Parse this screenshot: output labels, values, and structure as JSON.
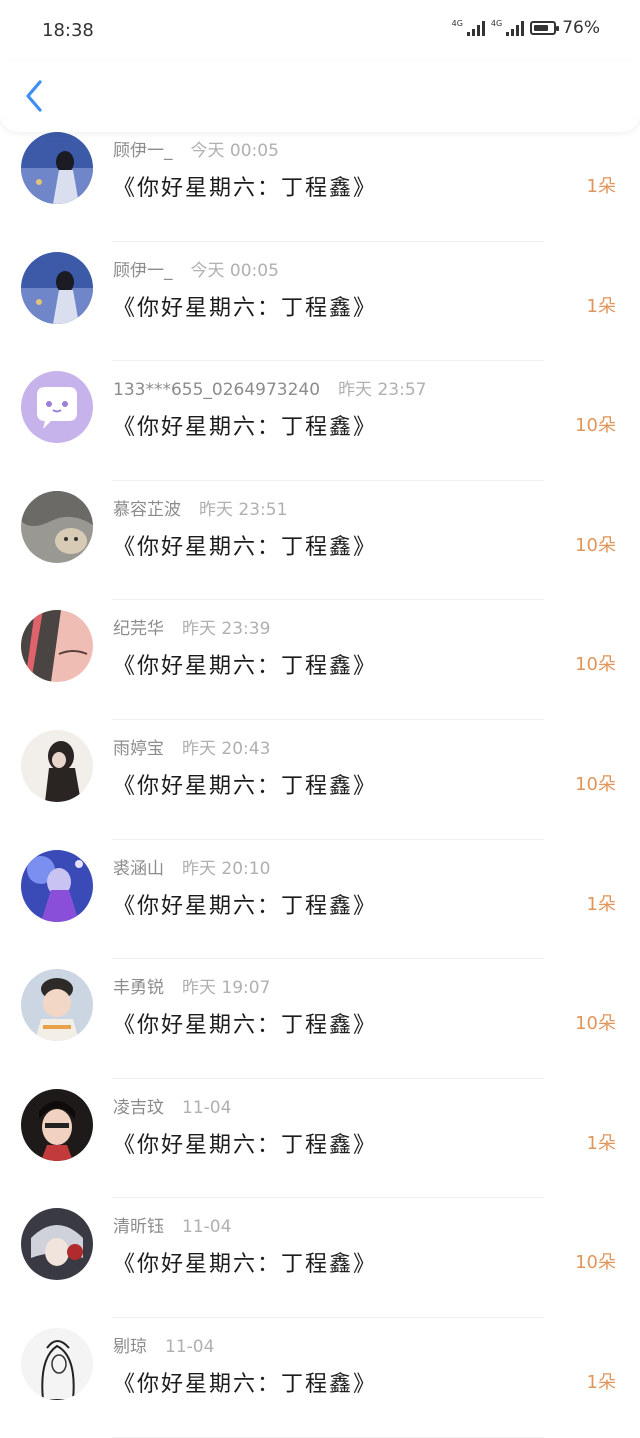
{
  "status_bar": {
    "time": "18:38",
    "network_1": "4G",
    "network_2": "4G",
    "battery_percent": "76%",
    "battery_level": 0.76
  },
  "gift_list": {
    "items": [
      {
        "user": "顾伊一_",
        "time": "今天 00:05",
        "title": "《你好星期六：丁程鑫》",
        "count": "1朵"
      },
      {
        "user": "顾伊一_",
        "time": "今天 00:05",
        "title": "《你好星期六：丁程鑫》",
        "count": "1朵"
      },
      {
        "user": "133***655_0264973240",
        "time": "昨天 23:57",
        "title": "《你好星期六：丁程鑫》",
        "count": "10朵"
      },
      {
        "user": "慕容芷波",
        "time": "昨天 23:51",
        "title": "《你好星期六：丁程鑫》",
        "count": "10朵"
      },
      {
        "user": "纪芫华",
        "time": "昨天 23:39",
        "title": "《你好星期六：丁程鑫》",
        "count": "10朵"
      },
      {
        "user": "雨婷宝",
        "time": "昨天 20:43",
        "title": "《你好星期六：丁程鑫》",
        "count": "10朵"
      },
      {
        "user": "裘涵山",
        "time": "昨天 20:10",
        "title": "《你好星期六：丁程鑫》",
        "count": "1朵"
      },
      {
        "user": "丰勇锐",
        "time": "昨天 19:07",
        "title": "《你好星期六：丁程鑫》",
        "count": "10朵"
      },
      {
        "user": "凌吉玟",
        "time": "11-04",
        "title": "《你好星期六：丁程鑫》",
        "count": "1朵"
      },
      {
        "user": "清昕钰",
        "time": "11-04",
        "title": "《你好星期六：丁程鑫》",
        "count": "10朵"
      },
      {
        "user": "剔琼",
        "time": "11-04",
        "title": "《你好星期六：丁程鑫》",
        "count": "1朵"
      }
    ]
  },
  "colors": {
    "accent_blue": "#3e8ef7",
    "count_orange": "#e0965a"
  }
}
